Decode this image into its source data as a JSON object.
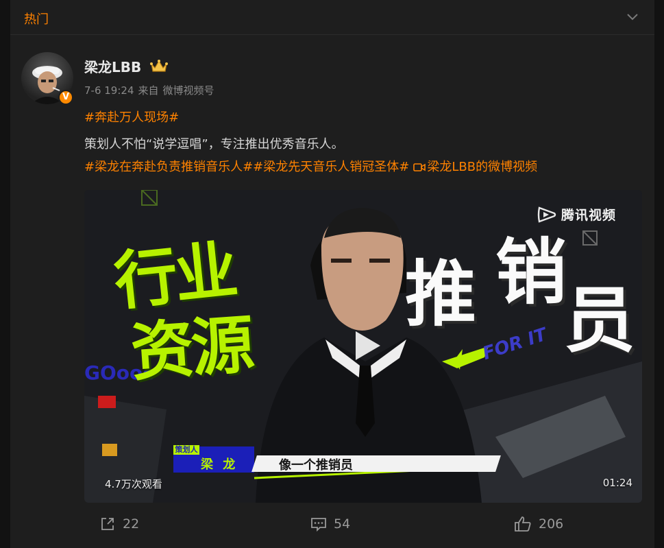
{
  "header": {
    "title": "热门"
  },
  "post": {
    "author": "梁龙LBB",
    "verified_mark": "V",
    "time": "7-6 19:24",
    "from_prefix": "来自",
    "source": "微博视频号",
    "topic1": "#奔赴万人现场#",
    "body": "策划人不怕“说学逗唱”，专注推出优秀音乐人。",
    "topic2": "#梁龙在奔赴负责推销音乐人#",
    "topic3": "#梁龙先天音乐人销冠圣体#",
    "video_link": "梁龙LBB的微博视频"
  },
  "video": {
    "watermark": "腾讯视频",
    "overlay_left_1": "行业",
    "overlay_left_2": "资源",
    "overlay_right_1": "推",
    "overlay_right_2": "销",
    "overlay_right_3": "员",
    "deco_for_it": "FOR IT",
    "deco_gooo": "GOooo",
    "role_tag": "策划人",
    "person_name": "梁 龙",
    "subtitle": "像一个推销员",
    "views": "4.7万次观看",
    "duration": "01:24"
  },
  "actions": {
    "repost_count": "22",
    "comment_count": "54",
    "like_count": "206"
  },
  "colors": {
    "accent": "#ff8200",
    "background": "#1e1e1e",
    "overlay_green": "#b7f200",
    "overlay_blue": "#1b1fb8"
  }
}
